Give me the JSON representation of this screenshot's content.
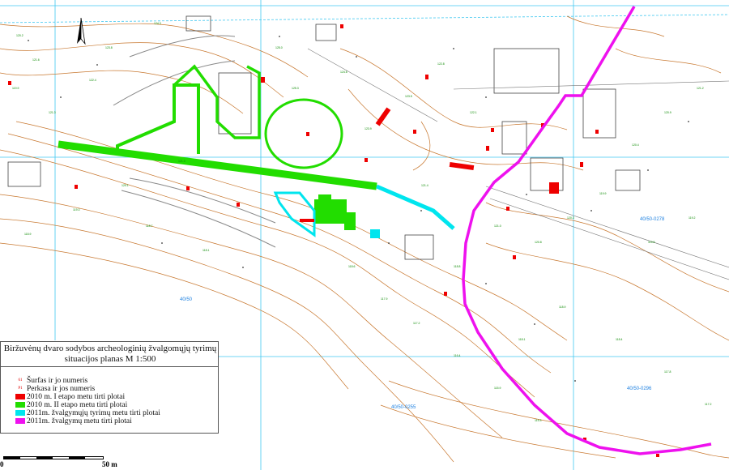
{
  "legend": {
    "title_lines": [
      "Biržuvėnų dvaro sodybos archeologinių žvalgomųjų tyrimų",
      "situacijos planas M 1:500"
    ],
    "items": [
      {
        "kind": "marker",
        "marker": "61",
        "label": "Šurfas ir jo numeris",
        "color": "#e00000"
      },
      {
        "kind": "marker",
        "marker": "P1",
        "label": "Perkasa ir jos numeris",
        "color": "#e00000"
      },
      {
        "kind": "swatch",
        "label": "2010 m. I etapo metu tirti plotai",
        "color": "#ee0000"
      },
      {
        "kind": "swatch",
        "label": "2010 m. II etapo metu tirti plotai",
        "color": "#22dd00"
      },
      {
        "kind": "swatch",
        "label": "2011m. žvalgymųjų tyrimų metu tirti plotai",
        "color": "#00e5ee"
      },
      {
        "kind": "swatch",
        "label": "2011m. žvalgymų metu tirti plotai",
        "color": "#ee11ee"
      }
    ]
  },
  "scale_bar": {
    "start": "0",
    "end": "50 m"
  },
  "plot_labels": [
    "40/50-0278",
    "40/50-0296",
    "40/50-0255",
    "40/50"
  ],
  "colors": {
    "contour": "#c87830",
    "grid": "#40c8f0",
    "elevation_text": "#0a8a00",
    "building": "#444444",
    "green": "#22dd00",
    "red": "#ee0000",
    "cyan": "#00e5ee",
    "magenta": "#ee11ee"
  },
  "north_arrow": "north-arrow-icon"
}
